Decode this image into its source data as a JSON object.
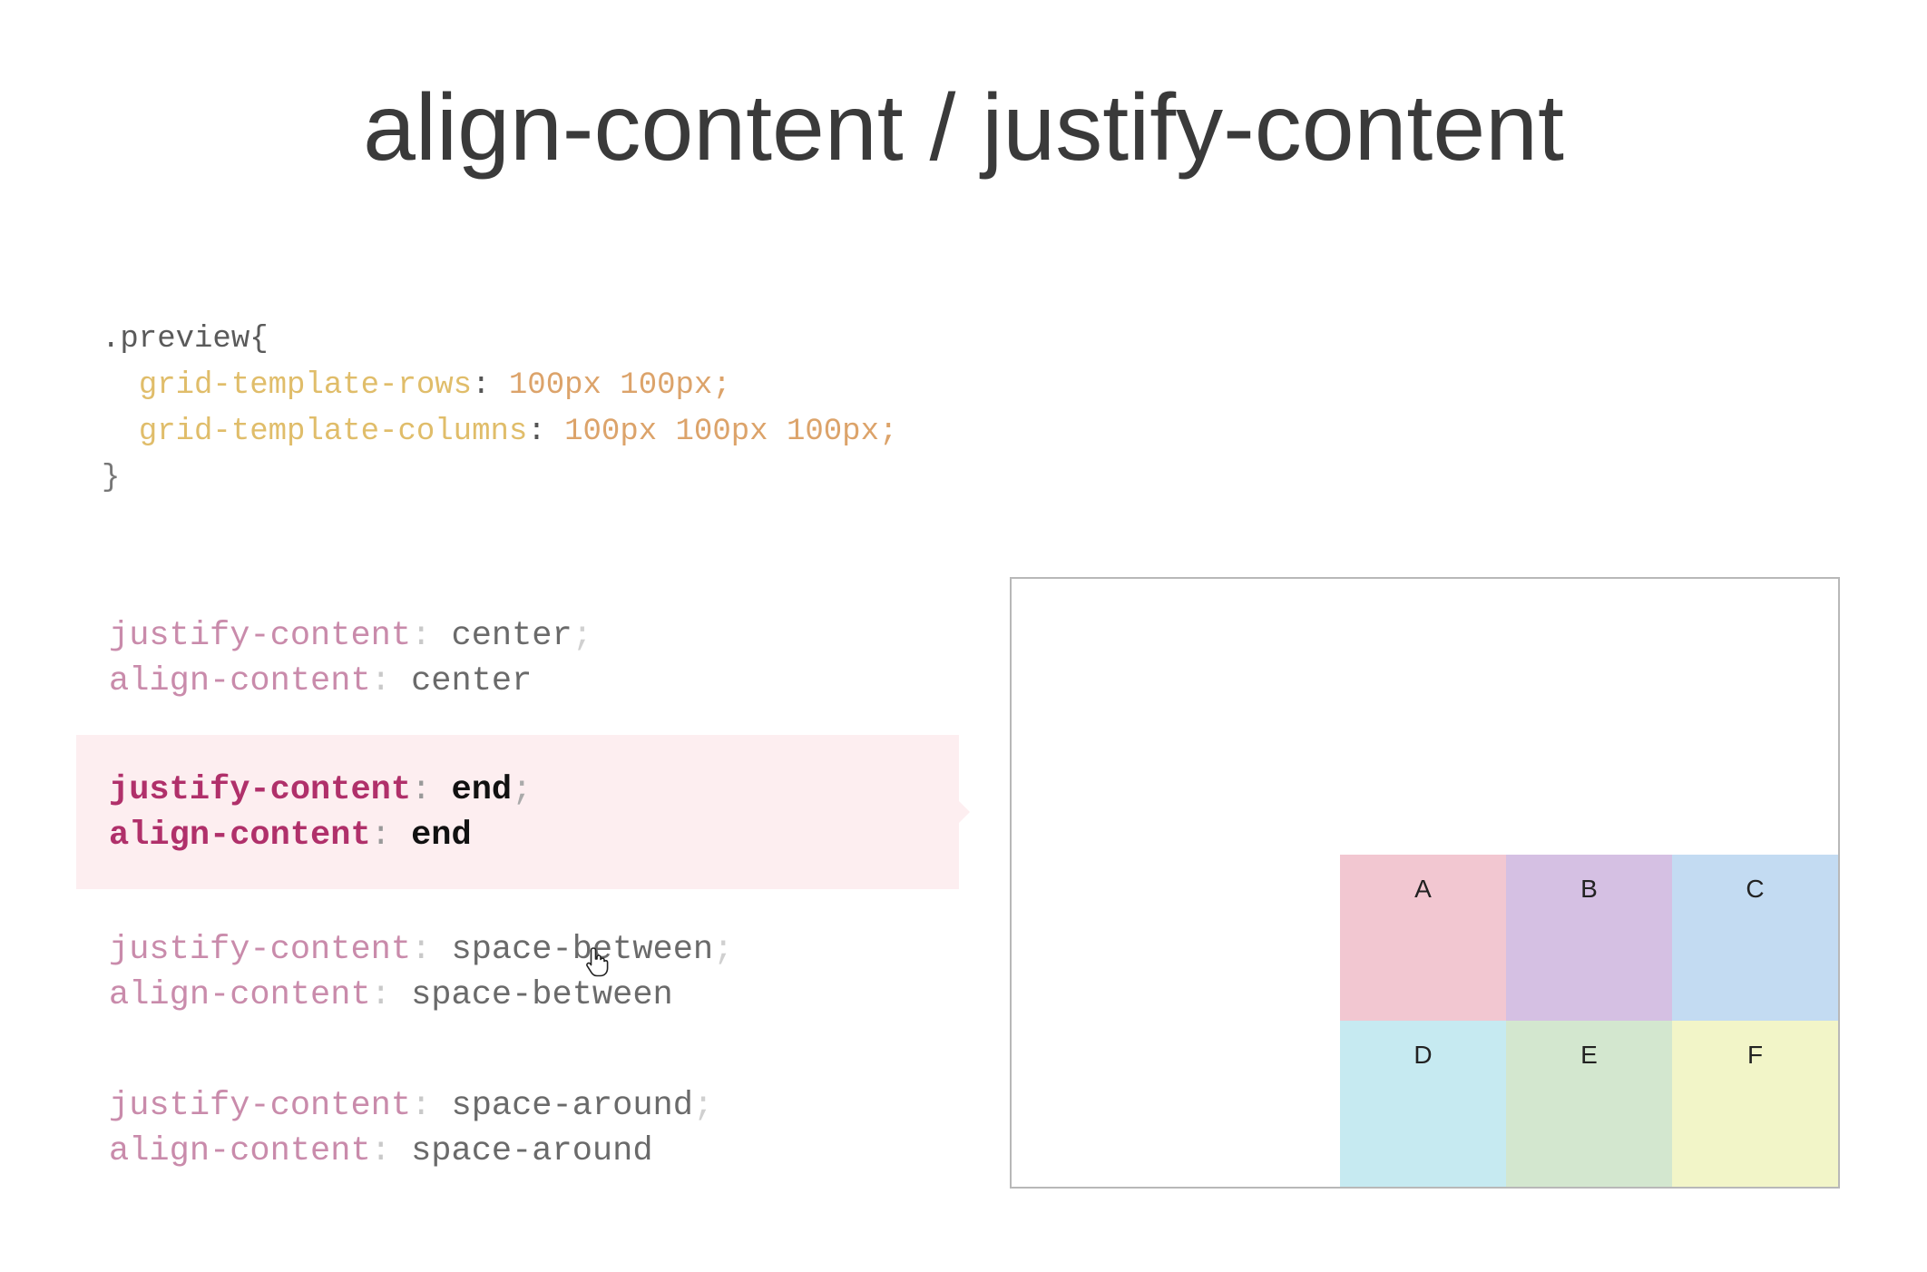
{
  "slide": {
    "title": "align-content / justify-content"
  },
  "code": {
    "selector": ".preview{",
    "rules": [
      {
        "property": "grid-template-rows",
        "value": "100px 100px;"
      },
      {
        "property": "grid-template-columns",
        "value": "100px 100px 100px;"
      }
    ],
    "close": "}"
  },
  "options": [
    {
      "justify_prop": "justify-content",
      "justify_value": "center",
      "align_prop": "align-content",
      "align_value": "center",
      "active": false
    },
    {
      "justify_prop": "justify-content",
      "justify_value": "end",
      "align_prop": "align-content",
      "align_value": "end",
      "active": true
    },
    {
      "justify_prop": "justify-content",
      "justify_value": "space-between",
      "align_prop": "align-content",
      "align_value": "space-between",
      "active": false
    },
    {
      "justify_prop": "justify-content",
      "justify_value": "space-around",
      "align_prop": "align-content",
      "align_value": "space-around",
      "active": false
    }
  ],
  "preview": {
    "cells": [
      {
        "label": "A",
        "color": "#f2c7d1"
      },
      {
        "label": "B",
        "color": "#d5c0e3"
      },
      {
        "label": "C",
        "color": "#c3dbf2"
      },
      {
        "label": "D",
        "color": "#c6eaf1"
      },
      {
        "label": "E",
        "color": "#d3e7cf"
      },
      {
        "label": "F",
        "color": "#f2f5c8"
      }
    ]
  },
  "cursor": {
    "icon": "hand-pointer-icon"
  }
}
